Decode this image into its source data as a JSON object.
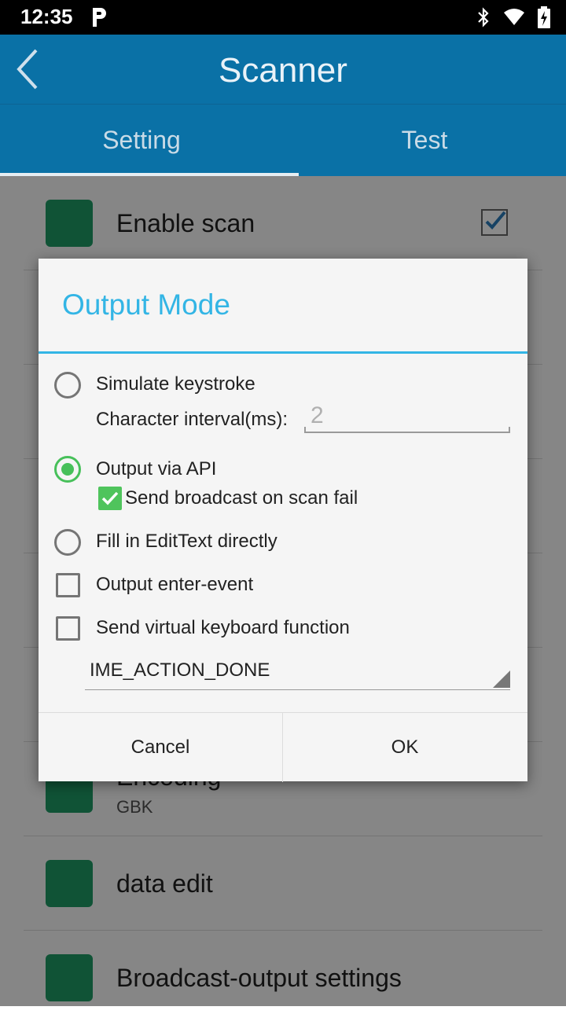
{
  "status_bar": {
    "time": "12:35"
  },
  "app_bar": {
    "title": "Scanner"
  },
  "tabs": [
    {
      "label": "Setting",
      "selected": true
    },
    {
      "label": "Test",
      "selected": false
    }
  ],
  "list_items": [
    {
      "title": "Enable scan",
      "checked": true
    },
    {
      "title": "Encoding",
      "subtitle": "GBK"
    },
    {
      "title": "data edit"
    },
    {
      "title": "Broadcast-output settings"
    }
  ],
  "dialog": {
    "title": "Output Mode",
    "options": {
      "simulate_keystroke": "Simulate keystroke",
      "character_interval_label": "Character interval(ms):",
      "character_interval_value": "2",
      "output_via_api": "Output via API",
      "send_broadcast_on_fail": "Send broadcast on scan fail",
      "fill_edittext": "Fill in EditText directly",
      "output_enter_event": "Output enter-event",
      "send_virtual_keyboard": "Send virtual keyboard function",
      "ime_action": "IME_ACTION_DONE"
    },
    "selected_option": "output_via_api",
    "cancel_label": "Cancel",
    "ok_label": "OK"
  },
  "colors": {
    "app_bar": "#0a71a6",
    "accent": "#33b5e5",
    "radio_checked": "#47c05a",
    "icon_green": "#1e9a64"
  }
}
